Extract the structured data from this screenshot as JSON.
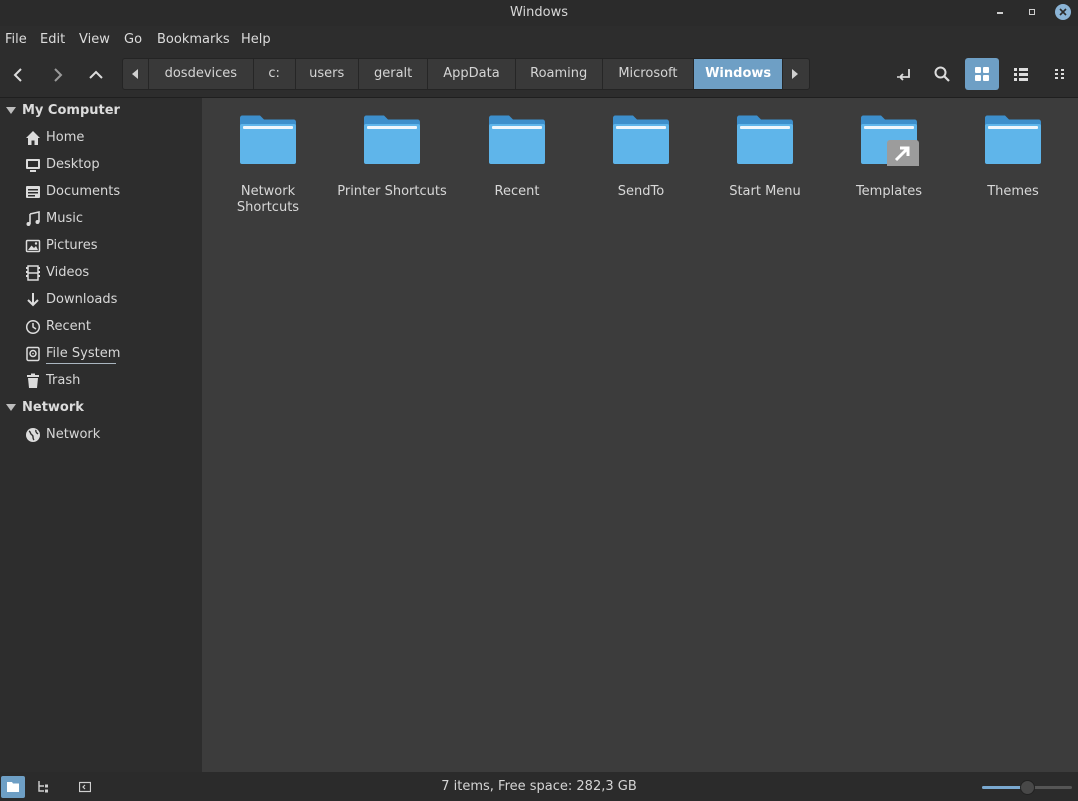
{
  "window": {
    "title": "Windows"
  },
  "menu": [
    "File",
    "Edit",
    "View",
    "Go",
    "Bookmarks",
    "Help"
  ],
  "breadcrumbs": [
    "dosdevices",
    "c:",
    "users",
    "geralt",
    "AppData",
    "Roaming",
    "Microsoft",
    "Windows"
  ],
  "breadcrumb_active": "Windows",
  "sidebar": {
    "sections": [
      {
        "title": "My Computer",
        "items": [
          {
            "label": "Home",
            "icon": "home-icon"
          },
          {
            "label": "Desktop",
            "icon": "desktop-icon"
          },
          {
            "label": "Documents",
            "icon": "documents-icon"
          },
          {
            "label": "Music",
            "icon": "music-icon"
          },
          {
            "label": "Pictures",
            "icon": "pictures-icon"
          },
          {
            "label": "Videos",
            "icon": "videos-icon"
          },
          {
            "label": "Downloads",
            "icon": "downloads-icon"
          },
          {
            "label": "Recent",
            "icon": "recent-icon"
          },
          {
            "label": "File System",
            "icon": "filesystem-icon"
          },
          {
            "label": "Trash",
            "icon": "trash-icon"
          }
        ]
      },
      {
        "title": "Network",
        "items": [
          {
            "label": "Network",
            "icon": "network-icon"
          }
        ]
      }
    ]
  },
  "files": [
    {
      "name": "Network\nShortcuts",
      "type": "folder"
    },
    {
      "name": "Printer Shortcuts",
      "type": "folder"
    },
    {
      "name": "Recent",
      "type": "folder"
    },
    {
      "name": "SendTo",
      "type": "folder"
    },
    {
      "name": "Start Menu",
      "type": "folder"
    },
    {
      "name": "Templates",
      "type": "folder-link"
    },
    {
      "name": "Themes",
      "type": "folder"
    }
  ],
  "status": {
    "text": "7 items, Free space: 282,3 GB"
  },
  "zoom_level": 0.5,
  "colors": {
    "accent": "#6e9fc5",
    "folder": "#5fb5ea",
    "folder_dark": "#3d8fcc"
  }
}
